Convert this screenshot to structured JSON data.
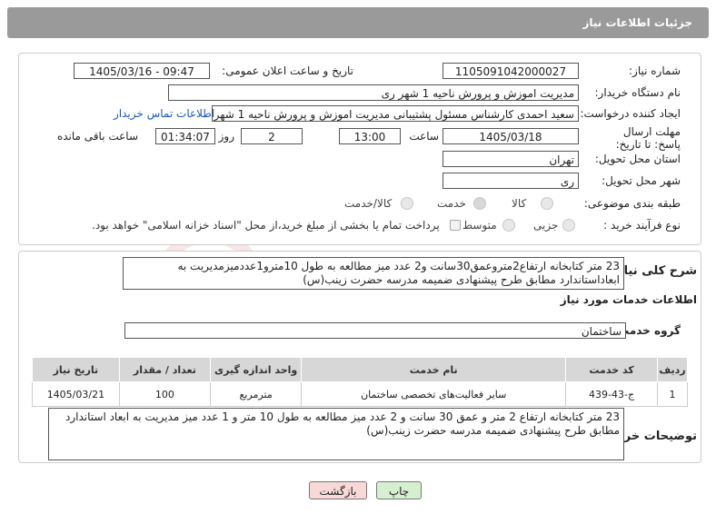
{
  "header": {
    "title": "جزئیات اطلاعات نیاز"
  },
  "form": {
    "need_number_label": "شماره نیاز:",
    "need_number": "1105091042000027",
    "announce_label": "تاریخ و ساعت اعلان عمومی:",
    "announce_value": "1405/03/16 - 09:47",
    "buyer_org_label": "نام دستگاه خریدار:",
    "buyer_org": "مدیریت اموزش و پرورش ناحیه 1 شهر ری",
    "creator_label": "ایجاد کننده درخواست:",
    "creator": "سعید احمدی کارشناس مسئول پشتیبانی مدیریت اموزش و پرورش ناحیه 1 شهر",
    "contact_link": "اطلاعات تماس خریدار",
    "deadline_label": "مهلت ارسال پاسخ: تا تاریخ:",
    "deadline_date": "1405/03/18",
    "hour_label": "ساعت",
    "deadline_time": "13:00",
    "days_value": "2",
    "days_label": "روز و",
    "remaining_time": "01:34:07",
    "remaining_label": "ساعت باقی مانده",
    "province_label": "استان محل تحویل:",
    "province": "تهران",
    "city_label": "شهر محل تحویل:",
    "city": "ری",
    "category_label": "طبقه بندی موضوعی:",
    "category_options": [
      "کالا",
      "خدمت",
      "کالا/خدمت"
    ],
    "category_selected": "خدمت",
    "process_label": "نوع فرآیند خرید :",
    "process_options": [
      "جزیی",
      "متوسط"
    ],
    "payment_note": "پرداخت تمام یا بخشی از مبلغ خرید،از محل \"اسناد خزانه اسلامی\" خواهد بود."
  },
  "summary": {
    "label": "شرح کلی نیاز:",
    "text": "23 متر کتابخانه ارتفاع2مترو‌عمق30سانت و2 عدد میز مطالعه به طول 10مترو1عددمیزمدیریت به ابعاداستاندارد مطابق طرح پیشنهادی ضمیمه مدرسه حضرت زینب(س)"
  },
  "services": {
    "section_title": "اطلاعات خدمات مورد نیاز",
    "group_label": "گروه خدمت:",
    "group_value": "ساختمان",
    "columns": [
      "ردیف",
      "کد خدمت",
      "نام خدمت",
      "واحد اندازه گیری",
      "تعداد / مقدار",
      "تاریخ نیاز"
    ],
    "rows": [
      [
        "1",
        "ج-43-439",
        "سایر فعالیت‌های تخصصی ساختمان",
        "مترمربع",
        "100",
        "1405/03/21"
      ]
    ]
  },
  "buyer_notes": {
    "label": "توضیحات خریدار:",
    "text": "23 متر کتابخانه ارتفاع 2  متر و عمق 30 سانت و 2 عدد میز مطالعه به طول 10 متر و 1 عدد میز مدیریت به ابعاد استاندارد مطابق طرح پیشنهادی ضمیمه مدرسه حضرت زینب(س)"
  },
  "buttons": {
    "print": "چاپ",
    "back": "بازگشت"
  },
  "colors": {
    "header_bg": "#9a9a9a",
    "link": "#1a57b5",
    "back_btn": "#f9d8d8",
    "print_btn": "#d6efd0"
  }
}
